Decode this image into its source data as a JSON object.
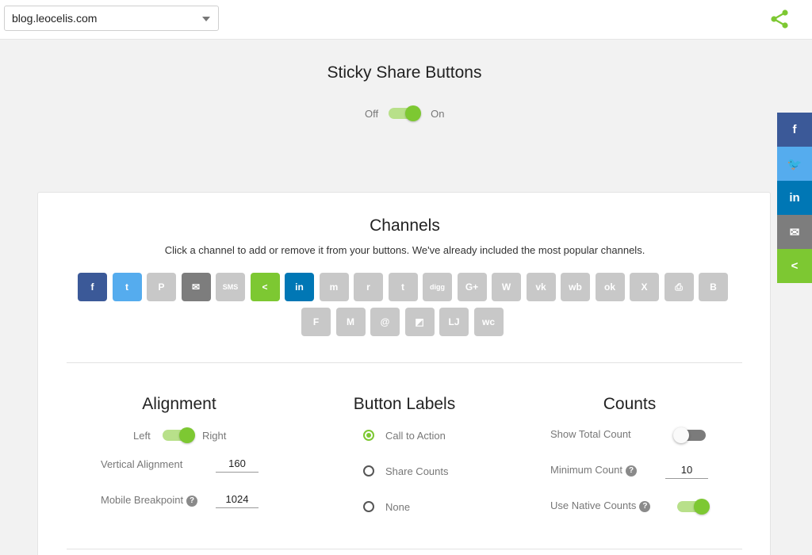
{
  "topbar": {
    "site_value": "blog.leocelis.com",
    "share_icon": "share-icon"
  },
  "header": {
    "title": "Sticky Share Buttons",
    "toggle": {
      "off_label": "Off",
      "on_label": "On",
      "state": "on"
    }
  },
  "sticky_bar": [
    {
      "name": "facebook",
      "glyph": "f",
      "color": "#3b5998"
    },
    {
      "name": "twitter",
      "glyph": "🐦",
      "color": "#55acee"
    },
    {
      "name": "linkedin",
      "glyph": "in",
      "color": "#0077b5"
    },
    {
      "name": "email",
      "glyph": "✉",
      "color": "#7d7d7d"
    },
    {
      "name": "sharethis",
      "glyph": "<",
      "color": "#7dc832"
    }
  ],
  "channels": {
    "title": "Channels",
    "description": "Click a channel to add or remove it from your buttons. We've already included the most popular channels.",
    "items": [
      {
        "name": "facebook",
        "glyph": "f",
        "active": true,
        "color": "#3b5998"
      },
      {
        "name": "twitter",
        "glyph": "t",
        "active": true,
        "color": "#55acee"
      },
      {
        "name": "pinterest",
        "glyph": "P",
        "active": false
      },
      {
        "name": "email",
        "glyph": "✉",
        "active": true,
        "color": "#7d7d7d"
      },
      {
        "name": "sms",
        "glyph": "SMS",
        "active": false
      },
      {
        "name": "sharethis",
        "glyph": "<",
        "active": true,
        "color": "#7dc832"
      },
      {
        "name": "linkedin",
        "glyph": "in",
        "active": true,
        "color": "#0077b5"
      },
      {
        "name": "messenger",
        "glyph": "m",
        "active": false
      },
      {
        "name": "reddit",
        "glyph": "r",
        "active": false
      },
      {
        "name": "tumblr",
        "glyph": "t",
        "active": false
      },
      {
        "name": "digg",
        "glyph": "digg",
        "active": false
      },
      {
        "name": "googleplus",
        "glyph": "G+",
        "active": false
      },
      {
        "name": "whatsapp",
        "glyph": "W",
        "active": false
      },
      {
        "name": "vk",
        "glyph": "vk",
        "active": false
      },
      {
        "name": "weibo",
        "glyph": "wb",
        "active": false
      },
      {
        "name": "odnoklassniki",
        "glyph": "ok",
        "active": false
      },
      {
        "name": "xing",
        "glyph": "X",
        "active": false
      },
      {
        "name": "print",
        "glyph": "⎙",
        "active": false
      },
      {
        "name": "blogger",
        "glyph": "B",
        "active": false
      },
      {
        "name": "flipboard",
        "glyph": "F",
        "active": false
      },
      {
        "name": "meneame",
        "glyph": "M",
        "active": false
      },
      {
        "name": "mailru",
        "glyph": "@",
        "active": false
      },
      {
        "name": "delicious",
        "glyph": "◩",
        "active": false
      },
      {
        "name": "livejournal",
        "glyph": "LJ",
        "active": false
      },
      {
        "name": "wechat",
        "glyph": "wc",
        "active": false
      }
    ]
  },
  "alignment": {
    "title": "Alignment",
    "left_label": "Left",
    "right_label": "Right",
    "toggle_state": "on",
    "vertical_label": "Vertical Alignment",
    "vertical_value": "160",
    "mobile_label": "Mobile Breakpoint",
    "mobile_value": "1024",
    "help_glyph": "?"
  },
  "button_labels": {
    "title": "Button Labels",
    "options": [
      {
        "label": "Call to Action",
        "selected": true
      },
      {
        "label": "Share Counts",
        "selected": false
      },
      {
        "label": "None",
        "selected": false
      }
    ]
  },
  "counts": {
    "title": "Counts",
    "show_total_label": "Show Total Count",
    "show_total_state": "off",
    "minimum_label": "Minimum Count",
    "minimum_value": "10",
    "native_label": "Use Native Counts",
    "native_state": "on"
  }
}
